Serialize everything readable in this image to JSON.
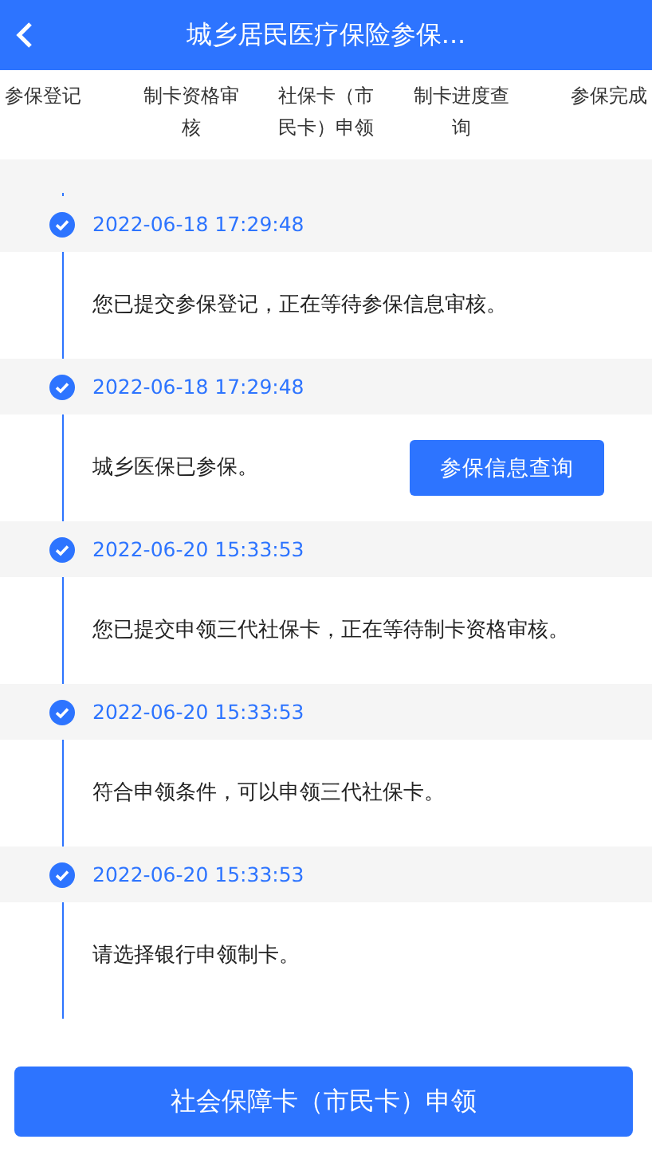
{
  "header": {
    "title": "城乡居民医疗保险参保..."
  },
  "steps": [
    {
      "label": "参保登记"
    },
    {
      "label": "制卡资格审核"
    },
    {
      "label": "社保卡（市民卡）申领"
    },
    {
      "label": "制卡进度查询"
    },
    {
      "label": "参保完成"
    }
  ],
  "timeline": [
    {
      "time": "2022-06-18 17:29:48",
      "message": "您已提交参保登记，正在等待参保信息审核。"
    },
    {
      "time": "2022-06-18 17:29:48",
      "message": "城乡医保已参保。",
      "action": "参保信息查询"
    },
    {
      "time": "2022-06-20 15:33:53",
      "message": "您已提交申领三代社保卡，正在等待制卡资格审核。"
    },
    {
      "time": "2022-06-20 15:33:53",
      "message": "符合申领条件，可以申领三代社保卡。"
    },
    {
      "time": "2022-06-20 15:33:53",
      "message": "请选择银行申领制卡。"
    }
  ],
  "primary_button": "社会保障卡（市民卡）申领"
}
